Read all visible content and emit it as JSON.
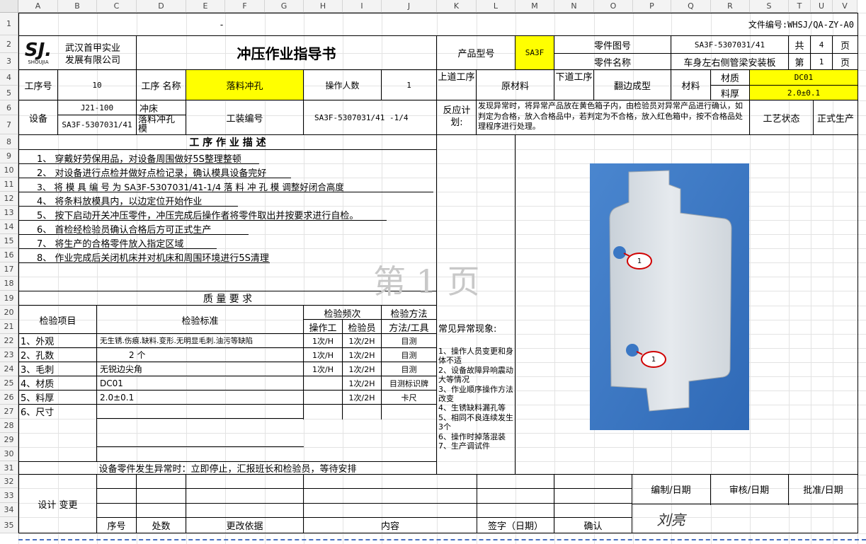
{
  "columns": [
    "A",
    "B",
    "C",
    "D",
    "E",
    "F",
    "G",
    "H",
    "I",
    "J",
    "K",
    "L",
    "M",
    "N",
    "O",
    "P",
    "Q",
    "R",
    "S",
    "T",
    "U",
    "V"
  ],
  "rows": [
    "1",
    "2",
    "3",
    "4",
    "5",
    "6",
    "7",
    "8",
    "9",
    "10",
    "11",
    "12",
    "13",
    "14",
    "15",
    "16",
    "17",
    "18",
    "19",
    "20",
    "21",
    "22",
    "23",
    "24",
    "25",
    "26",
    "27",
    "28",
    "29",
    "30",
    "31",
    "32",
    "33",
    "34",
    "35"
  ],
  "doc_number": "文件编号:WHSJ/QA-ZY-A0",
  "dash": "-",
  "company": {
    "logo": "SJ.",
    "logo_sub": "SHOUJIA",
    "name_line1": "武汉首甲实业",
    "name_line2": "发展有限公司"
  },
  "title": "冲压作业指导书",
  "product_model_label": "产品型号",
  "product_model": "SA3F",
  "part_no_label": "零件图号",
  "part_no": "SA3F-5307031/41",
  "part_name_label": "零件名称",
  "part_name": "车身左右侧管梁安装板",
  "total_label": "共",
  "total_pages": "4",
  "page_unit": "页",
  "page_label": "第",
  "page_no": "1",
  "page_unit2": "页",
  "op_no_label": "工序号",
  "op_no": "10",
  "op_name_label": "工序 名称",
  "op_name": "落料冲孔",
  "operators_label": "操作人数",
  "operators": "1",
  "prev_op_label": "上道工序",
  "prev_op": "原材料",
  "next_op_label": "下道工序",
  "next_op": "翻边成型",
  "material_label": "材料",
  "material_grade_label": "材质",
  "material_grade": "DC01",
  "thickness_label": "料厚",
  "thickness": "2.0±0.1",
  "equipment_label": "设备",
  "equipment_model": "J21-100",
  "equipment_type": "冲床",
  "die_no": "SA3F-5307031/41",
  "die_type": "落料冲孔模",
  "tooling_label": "工装编号",
  "tooling_no": "SA3F-5307031/41 -1/4",
  "reaction_label": "反应计划:",
  "reaction_text": "发现异常时，将异常产品放在黄色箱子内，由检验员对异常产品进行确认，如判定为合格，放入合格品中，若判定为不合格，放入红色箱中，按不合格品处理程序进行处理。",
  "process_state_label": "工艺状态",
  "process_state": "正式生产",
  "desc_title": "工 序 作 业 描 述",
  "steps": [
    "1、 穿戴好劳保用品，对设备周围做好5S整理整顿",
    "2、 对设备进行点检并做好点检记录，确认模具设备完好",
    "3、 将 模 具 编 号 为   SA3F-5307031/41-1/4   落 料 冲 孔 模 调整好闭合高度",
    "4、 将条料放模具内，以边定位开始作业",
    "5、 按下启动开关冲压零件，冲压完成后操作者将零件取出并按要求进行自检。",
    "6、 首检经检验员确认合格后方可正式生产",
    "7、 将生产的合格零件放入指定区域",
    "8、 作业完成后关闭机床并对机床和周围环境进行5S清理"
  ],
  "watermark": "第 1 页",
  "quality_title": "质 量 要 求",
  "inspect_item_label": "检验项目",
  "inspect_std_label": "检验标准",
  "freq_label": "检验频次",
  "method_label": "检验方法",
  "operator_col": "操作工",
  "inspector_col": "检验员",
  "method_tool_col": "方法/工具",
  "inspections": [
    {
      "item": "1、外观",
      "std": "无生锈.伤痕.缺料.变形.无明显毛刺.油污等缺陷",
      "op": "1次/H",
      "insp": "1次/2H",
      "method": "目测"
    },
    {
      "item": "2、孔数",
      "std": "2 个",
      "op": "1次/H",
      "insp": "1次/2H",
      "method": "目测"
    },
    {
      "item": "3、毛刺",
      "std": "无锐边尖角",
      "op": "1次/H",
      "insp": "1次/2H",
      "method": "目测"
    },
    {
      "item": "4、材质",
      "std": "DC01",
      "op": "",
      "insp": "1次/2H",
      "method": "目测标识牌"
    },
    {
      "item": "5、料厚",
      "std": "2.0±0.1",
      "op": "",
      "insp": "1次/2H",
      "method": "卡尺"
    },
    {
      "item": "6、尺寸",
      "std": "",
      "op": "",
      "insp": "",
      "method": ""
    }
  ],
  "abnormal_title": "常见异常现象:",
  "abnormal_text": "1、操作人员变更和身体不适\n2、设备故障异响震动大等情况\n3、作业顺序操作方法改变\n4、生锈缺料漏孔等\n5、相同不良连续发生3个\n6、操作时掉落混装\n7、生产调试件",
  "equipment_fault_note": "设备零件发生异常时：立即停止，汇报班长和检验员，等待安排",
  "design_change_label": "设计 变更",
  "change_cols": [
    "序号",
    "处数",
    "更改依据",
    "内容",
    "签字（日期）",
    "确认"
  ],
  "compile_label": "编制/日期",
  "review_label": "审核/日期",
  "approve_label": "批准/日期",
  "signature": "刘亮",
  "balloon": "1",
  "photo_colors": {
    "bg": "#3a77c4",
    "part": "#d8dfe6",
    "arrow": "#d00000"
  }
}
